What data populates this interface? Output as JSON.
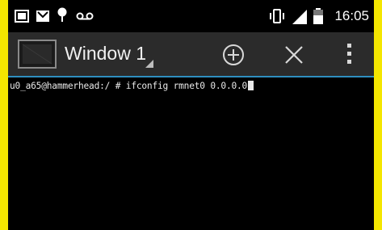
{
  "status_bar": {
    "time": "16:05",
    "icons": [
      "terminal-notification-icon",
      "gmail-icon",
      "android-icon",
      "voicemail-icon",
      "vibrate-icon",
      "signal-icon",
      "battery-icon"
    ]
  },
  "action_bar": {
    "window_title": "Window 1",
    "buttons": [
      "add-window-icon",
      "close-window-icon",
      "overflow-menu-icon"
    ]
  },
  "terminal": {
    "prompt": "u0_a65@hammerhead:/ # ",
    "command": "ifconfig rmnet0 0.0.0.0"
  },
  "colors": {
    "background_frame": "#f4e600",
    "action_bar": "#2b2b2b",
    "divider": "#2e8ec0",
    "terminal_bg": "#000000",
    "terminal_fg": "#e8e8e8"
  }
}
